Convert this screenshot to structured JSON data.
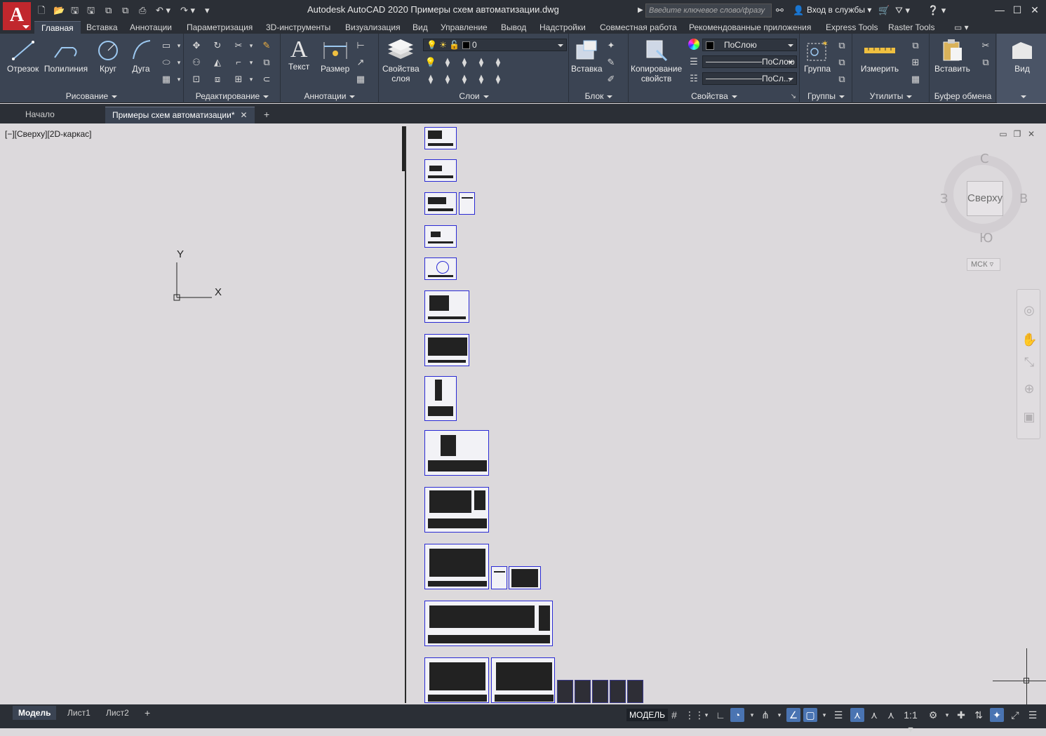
{
  "app": {
    "logo_letter": "A",
    "window_title": "Autodesk AutoCAD 2020    Примеры схем автоматизации.dwg",
    "search_placeholder": "Введите ключевое слово/фразу",
    "signin_label": "Вход в службы"
  },
  "quick_access": [
    "new-file-icon",
    "open-icon",
    "save-icon",
    "save-as-icon",
    "open-web-icon",
    "save-web-icon",
    "plot-icon",
    "undo-icon",
    "redo-icon",
    "customize-icon"
  ],
  "ribbon_tabs": [
    {
      "label": "Главная",
      "active": true
    },
    {
      "label": "Вставка"
    },
    {
      "label": "Аннотации"
    },
    {
      "label": "Параметризация"
    },
    {
      "label": "3D-инструменты"
    },
    {
      "label": "Визуализация"
    },
    {
      "label": "Вид"
    },
    {
      "label": "Управление"
    },
    {
      "label": "Вывод"
    },
    {
      "label": "Надстройки"
    },
    {
      "label": "Совместная работа"
    },
    {
      "label": "Рекомендованные приложения"
    },
    {
      "label": "Express Tools"
    },
    {
      "label": "Raster Tools"
    }
  ],
  "panels": {
    "draw": {
      "title": "Рисование",
      "tools": [
        "Отрезок",
        "Полилиния",
        "Круг",
        "Дуга"
      ]
    },
    "modify": {
      "title": "Редактирование"
    },
    "annotation": {
      "title": "Аннотации",
      "tools": [
        "Текст",
        "Размер"
      ]
    },
    "layers": {
      "title": "Слои",
      "tool": "Свойства слоя",
      "tool_line1": "Свойства",
      "tool_line2": "слоя",
      "current_layer": "0"
    },
    "block": {
      "title": "Блок",
      "tool": "Вставка"
    },
    "properties": {
      "title": "Свойства",
      "tool_line1": "Копирование",
      "tool_line2": "свойств",
      "color": "ПоСлою",
      "linetype": "ПоСлою",
      "lineweight": "ПоСл..."
    },
    "groups": {
      "title": "Группы",
      "tool": "Группа"
    },
    "utilities": {
      "title": "Утилиты",
      "tool": "Измерить"
    },
    "clipboard": {
      "title": "Буфер обмена",
      "tool": "Вставить"
    },
    "view": {
      "tool": "Вид"
    }
  },
  "file_tabs": [
    {
      "label": "Начало"
    },
    {
      "label": "Примеры схем автоматизации*",
      "active": true
    }
  ],
  "viewport": {
    "label": "[−][Сверху][2D-каркас]",
    "ucs_x": "X",
    "ucs_y": "Y"
  },
  "viewcube": {
    "face": "Сверху",
    "north": "С",
    "south": "Ю",
    "west": "З",
    "east": "В",
    "ucs_menu": "МСК"
  },
  "layout_tabs": [
    {
      "label": "Модель",
      "active": true
    },
    {
      "label": "Лист1"
    },
    {
      "label": "Лист2"
    }
  ],
  "status": {
    "mode": "МОДЕЛЬ",
    "scale": "1:1"
  },
  "colors": {
    "ribbon_bg": "#3b4453",
    "titlebar_bg": "#2b2f36",
    "canvas_bg": "#dcd9dc",
    "logo_red": "#c1272d",
    "sheet_border": "#2a2ad4",
    "status_on": "#4a74b2"
  }
}
